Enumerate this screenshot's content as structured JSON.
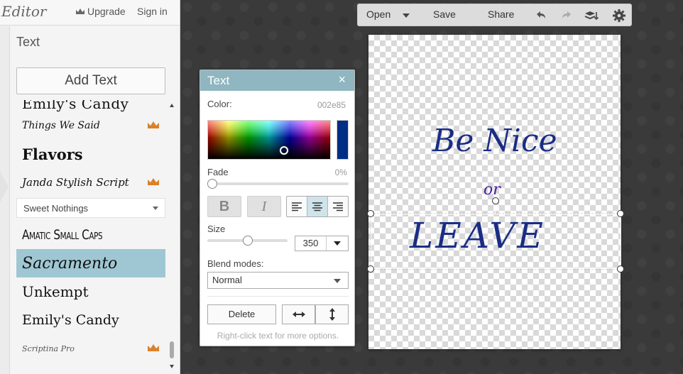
{
  "app": {
    "brand": "Editor",
    "upgrade_label": "Upgrade",
    "signin_label": "Sign in"
  },
  "sidebar": {
    "section_title": "Text",
    "add_text_label": "Add Text",
    "fonts": [
      {
        "label": "Emily's Candy",
        "premium": false
      },
      {
        "label": "Things We Said",
        "premium": true
      },
      {
        "label": "Flavors",
        "premium": false
      },
      {
        "label": "Janda Stylish Script",
        "premium": true
      },
      {
        "label": "Sweet Nothings",
        "type": "select"
      },
      {
        "label": "Amatic Small Caps",
        "premium": false
      },
      {
        "label": "Sacramento",
        "premium": false,
        "selected": true
      },
      {
        "label": "Unkempt",
        "premium": false
      },
      {
        "label": "Emily's Candy",
        "premium": false
      },
      {
        "label": "Scriptina Pro",
        "premium": true
      }
    ]
  },
  "toolbar": {
    "open_label": "Open",
    "save_label": "Save",
    "share_label": "Share",
    "icons": [
      "undo-icon",
      "redo-icon",
      "layers-icon",
      "settings-icon"
    ]
  },
  "text_dialog": {
    "title": "Text",
    "close": "×",
    "color_label": "Color:",
    "color_value": "002e85",
    "swatch_color": "#002e85",
    "fade_label": "Fade",
    "fade_value": "0%",
    "bold_label": "B",
    "italic_label": "I",
    "alignment": "center",
    "size_label": "Size",
    "size_value": "350",
    "blend_label": "Blend modes:",
    "blend_value": "Normal",
    "delete_label": "Delete",
    "hint": "Right-click text for more options."
  },
  "canvas": {
    "layers": [
      {
        "text": "Be Nice",
        "color": "#1a2d85"
      },
      {
        "text": "or",
        "color": "#4a1fa0"
      },
      {
        "text": "LEAVE",
        "color": "#1a2d85"
      }
    ]
  },
  "colors": {
    "accent": "#9fc7d3",
    "dialog_header": "#8fb6c1",
    "premium_crown": "#d9822b"
  }
}
